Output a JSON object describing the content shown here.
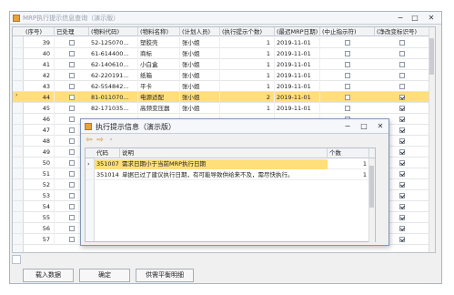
{
  "window": {
    "title": "MRP执行提示信息查询（演示版）",
    "minimize": "−",
    "maximize": "□",
    "close": "✕"
  },
  "table": {
    "columns": [
      "(序号)",
      "已处理",
      "(物料代码)",
      "(物料名称)",
      "(计划人员)",
      "(执行提示个数)",
      "(最迟MRP日期)",
      "(中止指示符)",
      "(净改变标识号)"
    ],
    "rows": [
      {
        "seq": "39",
        "done": false,
        "code": "52-125070...",
        "name": "塑胶壳",
        "planner": "张小姐",
        "count": "1",
        "date": "2019-11-01",
        "stop": false,
        "net": false
      },
      {
        "seq": "40",
        "done": false,
        "code": "61-614400...",
        "name": "商标",
        "planner": "张小姐",
        "count": "1",
        "date": "2019-11-01",
        "stop": false,
        "net": false
      },
      {
        "seq": "41",
        "done": false,
        "code": "62-140610...",
        "name": "小白盒",
        "planner": "张小姐",
        "count": "1",
        "date": "2019-11-01",
        "stop": false,
        "net": false
      },
      {
        "seq": "42",
        "done": false,
        "code": "62-220191...",
        "name": "纸箱",
        "planner": "张小姐",
        "count": "1",
        "date": "2019-11-01",
        "stop": false,
        "net": false
      },
      {
        "seq": "43",
        "done": false,
        "code": "62-554842...",
        "name": "平卡",
        "planner": "张小姐",
        "count": "1",
        "date": "2019-11-01",
        "stop": false,
        "net": false
      },
      {
        "seq": "44",
        "done": false,
        "code": "81-011070...",
        "name": "电源适配",
        "planner": "张小姐",
        "count": "2",
        "date": "2019-11-01",
        "stop": false,
        "net": true
      },
      {
        "seq": "45",
        "done": false,
        "code": "82-171035...",
        "name": "高频变压器",
        "planner": "张小姐",
        "count": "1",
        "date": "2019-11-01",
        "stop": false,
        "net": true
      },
      {
        "seq": "46",
        "done": false,
        "code": "",
        "name": "",
        "planner": "",
        "count": "",
        "date": "",
        "stop": false,
        "net": true
      },
      {
        "seq": "47",
        "done": false,
        "code": "",
        "name": "",
        "planner": "",
        "count": "",
        "date": "",
        "stop": false,
        "net": true
      },
      {
        "seq": "48",
        "done": false,
        "code": "",
        "name": "",
        "planner": "",
        "count": "",
        "date": "",
        "stop": false,
        "net": true
      },
      {
        "seq": "49",
        "done": false,
        "code": "",
        "name": "",
        "planner": "",
        "count": "",
        "date": "",
        "stop": false,
        "net": true
      },
      {
        "seq": "50",
        "done": false,
        "code": "",
        "name": "",
        "planner": "",
        "count": "",
        "date": "",
        "stop": false,
        "net": true
      },
      {
        "seq": "51",
        "done": false,
        "code": "",
        "name": "",
        "planner": "",
        "count": "",
        "date": "",
        "stop": false,
        "net": true
      },
      {
        "seq": "52",
        "done": false,
        "code": "",
        "name": "",
        "planner": "",
        "count": "",
        "date": "",
        "stop": false,
        "net": true
      },
      {
        "seq": "53",
        "done": false,
        "code": "",
        "name": "",
        "planner": "",
        "count": "",
        "date": "",
        "stop": false,
        "net": true
      },
      {
        "seq": "54",
        "done": false,
        "code": "",
        "name": "",
        "planner": "",
        "count": "",
        "date": "",
        "stop": false,
        "net": true
      },
      {
        "seq": "55",
        "done": false,
        "code": "",
        "name": "",
        "planner": "",
        "count": "",
        "date": "",
        "stop": false,
        "net": true
      },
      {
        "seq": "56",
        "done": false,
        "code": "",
        "name": "",
        "planner": "",
        "count": "",
        "date": "",
        "stop": false,
        "net": true
      },
      {
        "seq": "57",
        "done": false,
        "code": "",
        "name": "",
        "planner": "",
        "count": "",
        "date": "",
        "stop": false,
        "net": true
      }
    ],
    "current_row_marker": "›"
  },
  "buttons": {
    "load": "载入数据",
    "confirm": "确定",
    "balance": "供需平衡明细"
  },
  "dialog": {
    "title": "执行提示信息（演示版）",
    "minimize": "−",
    "maximize": "□",
    "close": "✕",
    "back": "⇦",
    "forward": "⇨",
    "menu_dot": "·",
    "columns": [
      "代码",
      "说明",
      "个数"
    ],
    "rows": [
      {
        "code": "351007",
        "desc": "需求日期小于当前MRP执行日期",
        "count": "1"
      },
      {
        "code": "351014",
        "desc": "单据已过了建议执行日期，有可能导致供给来不及，需尽快执行。",
        "count": "1"
      }
    ],
    "current_row_marker": "›"
  }
}
